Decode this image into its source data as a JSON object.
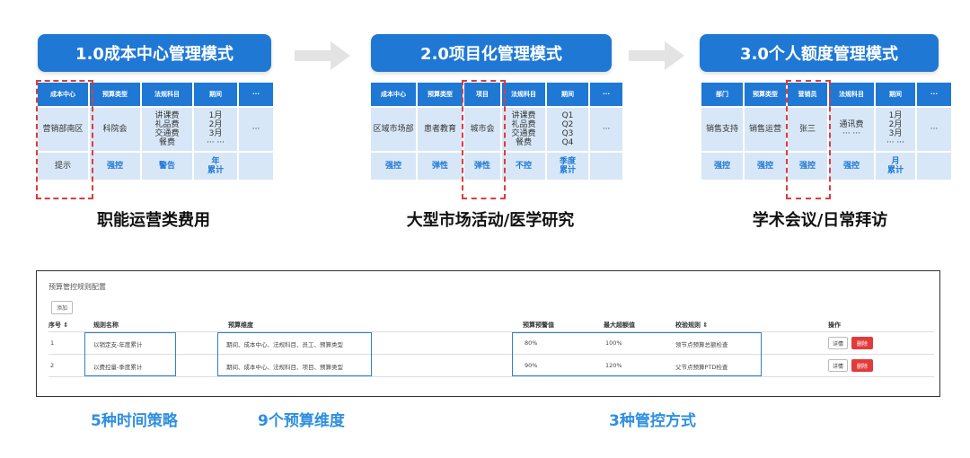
{
  "modes": [
    {
      "title": "1.0成本中心管理模式",
      "columns": [
        "成本中心",
        "预算类型",
        "法规科目",
        "期间",
        "···"
      ],
      "row1": [
        "营销部南区",
        "科院会",
        "讲课费\n礼品费\n交通费\n餐费",
        "1月\n2月\n3月\n··· ···",
        "···"
      ],
      "row2": [
        "提示",
        "强控",
        "警告",
        "年\n累计",
        ""
      ],
      "caption": "职能运营类费用"
    },
    {
      "title": "2.0项目化管理模式",
      "columns": [
        "成本中心",
        "预算类型",
        "项目",
        "法规科目",
        "期间",
        "···"
      ],
      "row1": [
        "区域市场部",
        "患者教育",
        "城市会",
        "讲课费\n礼品费\n交通费\n餐费",
        "Q1\nQ2\nQ3\nQ4",
        "···"
      ],
      "row2": [
        "强控",
        "弹性",
        "弹性",
        "不控",
        "季度\n累计",
        ""
      ],
      "caption": "大型市场活动/医学研究"
    },
    {
      "title": "3.0个人额度管理模式",
      "columns": [
        "部门",
        "预算类型",
        "营销员",
        "法规科目",
        "期间",
        "···"
      ],
      "row1": [
        "销售支持",
        "销售运营",
        "张三",
        "通讯费\n··· ···",
        "1月\n2月\n3月\n··· ···",
        "···"
      ],
      "row2": [
        "强控",
        "强控",
        "强控",
        "强控",
        "月\n累计",
        ""
      ],
      "caption": "学术会议/日常拜访"
    }
  ],
  "config": {
    "title": "预算管控规则配置",
    "add_label": "添加",
    "headers": [
      "序号 ⇕",
      "规则名称",
      "预算维度",
      "预算预警值",
      "最大超额值",
      "校验规则 ⇕",
      "操作"
    ],
    "rows": [
      {
        "no": "1",
        "name": "以销定支-年度累计",
        "dims": "期间、成本中心、法规科目、员工、预算类型",
        "warn": "80%",
        "max": "100%",
        "rule": "领节点预算总额检查"
      },
      {
        "no": "2",
        "name": "以费控量-季度累计",
        "dims": "期间、成本中心、法规科目、项目、预算类型",
        "warn": "90%",
        "max": "120%",
        "rule": "父节点预算PTD检查"
      }
    ],
    "detail_label": "详情",
    "delete_label": "删除"
  },
  "labels": {
    "time_strategy": "5种时间策略",
    "budget_dims": "9个预算维度",
    "control_modes": "3种管控方式"
  },
  "colors": {
    "primary": "#1f78d4",
    "cell_bg": "#d7e7f7",
    "highlight_red": "#e03b3b",
    "label_blue": "#2f8fe0"
  }
}
